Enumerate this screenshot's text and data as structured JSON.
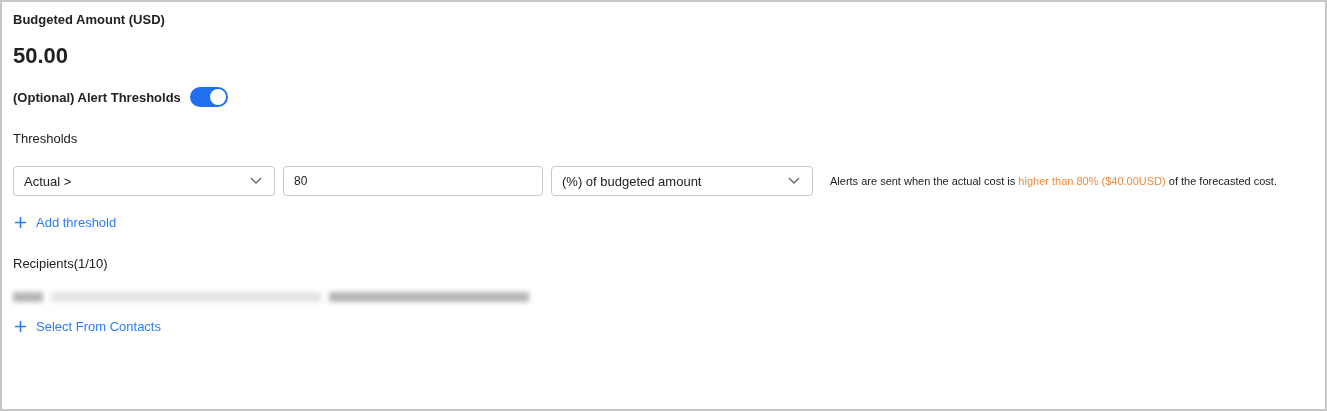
{
  "budget": {
    "label": "Budgeted Amount (USD)",
    "amount": "50.00"
  },
  "alert_thresholds": {
    "label": "(Optional) Alert Thresholds",
    "on": true
  },
  "thresholds": {
    "label": "Thresholds",
    "rows": [
      {
        "type": "Actual >",
        "value": "80",
        "unit": "(%) of budgeted amount",
        "note": "Alerts are sent when the actual cost is ",
        "note_highlight": "higher than 80% ($40.00USD)",
        "note_end": " of the forecasted cost."
      }
    ],
    "add_label": "Add threshold"
  },
  "recipients": {
    "label": "Recipients(1/10)",
    "add_label": "Select From Contacts"
  }
}
